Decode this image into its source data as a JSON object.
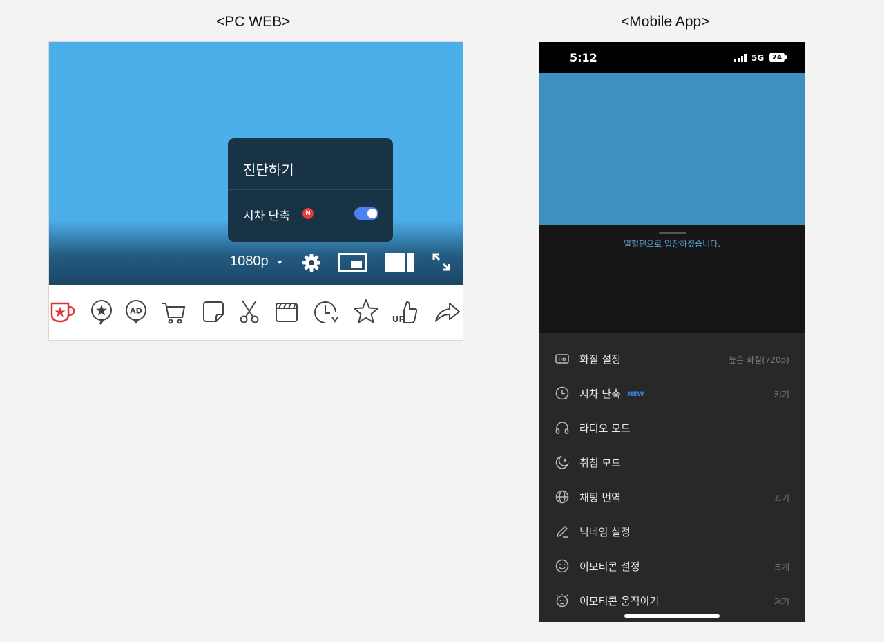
{
  "captions": {
    "pc": "<PC WEB>",
    "mobile": "<Mobile App>"
  },
  "pc_web": {
    "popup": {
      "title": "진단하기",
      "timeshift_label": "시차 단축",
      "badge": "N",
      "toggle_on": true
    },
    "controls": {
      "quality": "1080p",
      "icons": [
        "settings-gear-icon",
        "picture-in-picture-icon",
        "wide-mode-icon",
        "fullscreen-icon"
      ]
    },
    "toolbar_icons": [
      "red-cup-star-icon",
      "star-bubble-icon",
      "ad-balloon-icon",
      "shopping-cart-icon",
      "sticker-note-icon",
      "scissors-icon",
      "clapperboard-icon",
      "clock-history-icon",
      "star-icon",
      "thumbs-up-icon",
      "share-arrow-icon"
    ],
    "colors": {
      "video": "#4dafea",
      "popup": "#183346",
      "toggle": "#4c82f0",
      "badge": "#e93b3b"
    }
  },
  "mobile_app": {
    "status_bar": {
      "time": "5:12",
      "network": "5G",
      "battery": "74"
    },
    "chat_message": "열혈팬으로 입장하셨습니다.",
    "menu": [
      {
        "icon": "hq-icon",
        "label": "화질 설정",
        "value": "높은 화질(720p)"
      },
      {
        "icon": "clock-icon",
        "label": "시차 단축",
        "badge": "NEW",
        "value": "켜기"
      },
      {
        "icon": "headphones-icon",
        "label": "라디오 모드",
        "value": ""
      },
      {
        "icon": "moon-icon",
        "label": "취침 모드",
        "value": ""
      },
      {
        "icon": "globe-icon",
        "label": "채팅 번역",
        "value": "끄기"
      },
      {
        "icon": "pencil-icon",
        "label": "닉네임 설정",
        "value": ""
      },
      {
        "icon": "smile-icon",
        "label": "이모티콘 설정",
        "value": "크게"
      },
      {
        "icon": "animated-emoji-icon",
        "label": "이모티콘 움직이기",
        "value": "켜기"
      }
    ]
  }
}
